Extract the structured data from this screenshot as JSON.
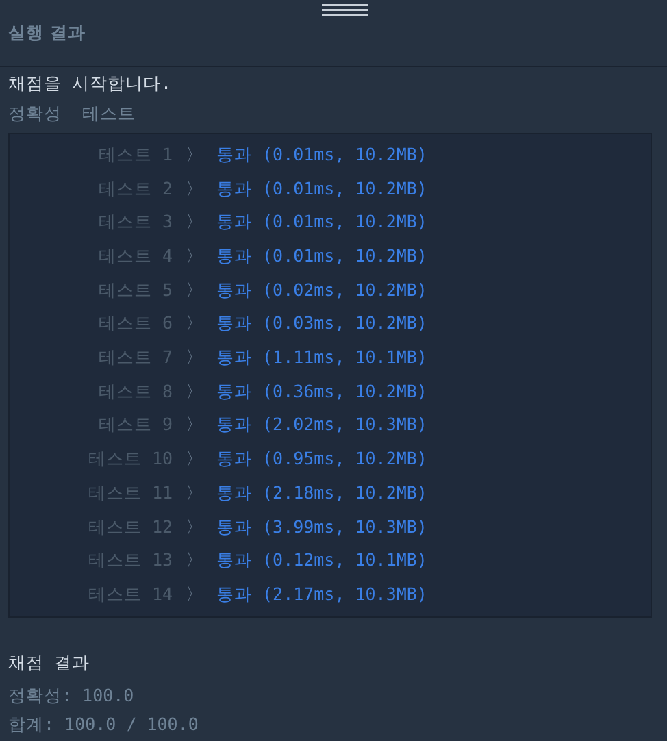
{
  "panel": {
    "title": "실행 결과"
  },
  "start_message": "채점을 시작합니다.",
  "section_label": "정확성  테스트",
  "tests": [
    {
      "label": "테스트 1",
      "separator": "〉",
      "result": "통과 (0.01ms, 10.2MB)"
    },
    {
      "label": "테스트 2",
      "separator": "〉",
      "result": "통과 (0.01ms, 10.2MB)"
    },
    {
      "label": "테스트 3",
      "separator": "〉",
      "result": "통과 (0.01ms, 10.2MB)"
    },
    {
      "label": "테스트 4",
      "separator": "〉",
      "result": "통과 (0.01ms, 10.2MB)"
    },
    {
      "label": "테스트 5",
      "separator": "〉",
      "result": "통과 (0.02ms, 10.2MB)"
    },
    {
      "label": "테스트 6",
      "separator": "〉",
      "result": "통과 (0.03ms, 10.2MB)"
    },
    {
      "label": "테스트 7",
      "separator": "〉",
      "result": "통과 (1.11ms, 10.1MB)"
    },
    {
      "label": "테스트 8",
      "separator": "〉",
      "result": "통과 (0.36ms, 10.2MB)"
    },
    {
      "label": "테스트 9",
      "separator": "〉",
      "result": "통과 (2.02ms, 10.3MB)"
    },
    {
      "label": "테스트 10",
      "separator": "〉",
      "result": "통과 (0.95ms, 10.2MB)"
    },
    {
      "label": "테스트 11",
      "separator": "〉",
      "result": "통과 (2.18ms, 10.2MB)"
    },
    {
      "label": "테스트 12",
      "separator": "〉",
      "result": "통과 (3.99ms, 10.3MB)"
    },
    {
      "label": "테스트 13",
      "separator": "〉",
      "result": "통과 (0.12ms, 10.1MB)"
    },
    {
      "label": "테스트 14",
      "separator": "〉",
      "result": "통과 (2.17ms, 10.3MB)"
    }
  ],
  "summary": {
    "title": "채점 결과",
    "lines": [
      "정확성: 100.0",
      "합계: 100.0 / 100.0"
    ]
  }
}
